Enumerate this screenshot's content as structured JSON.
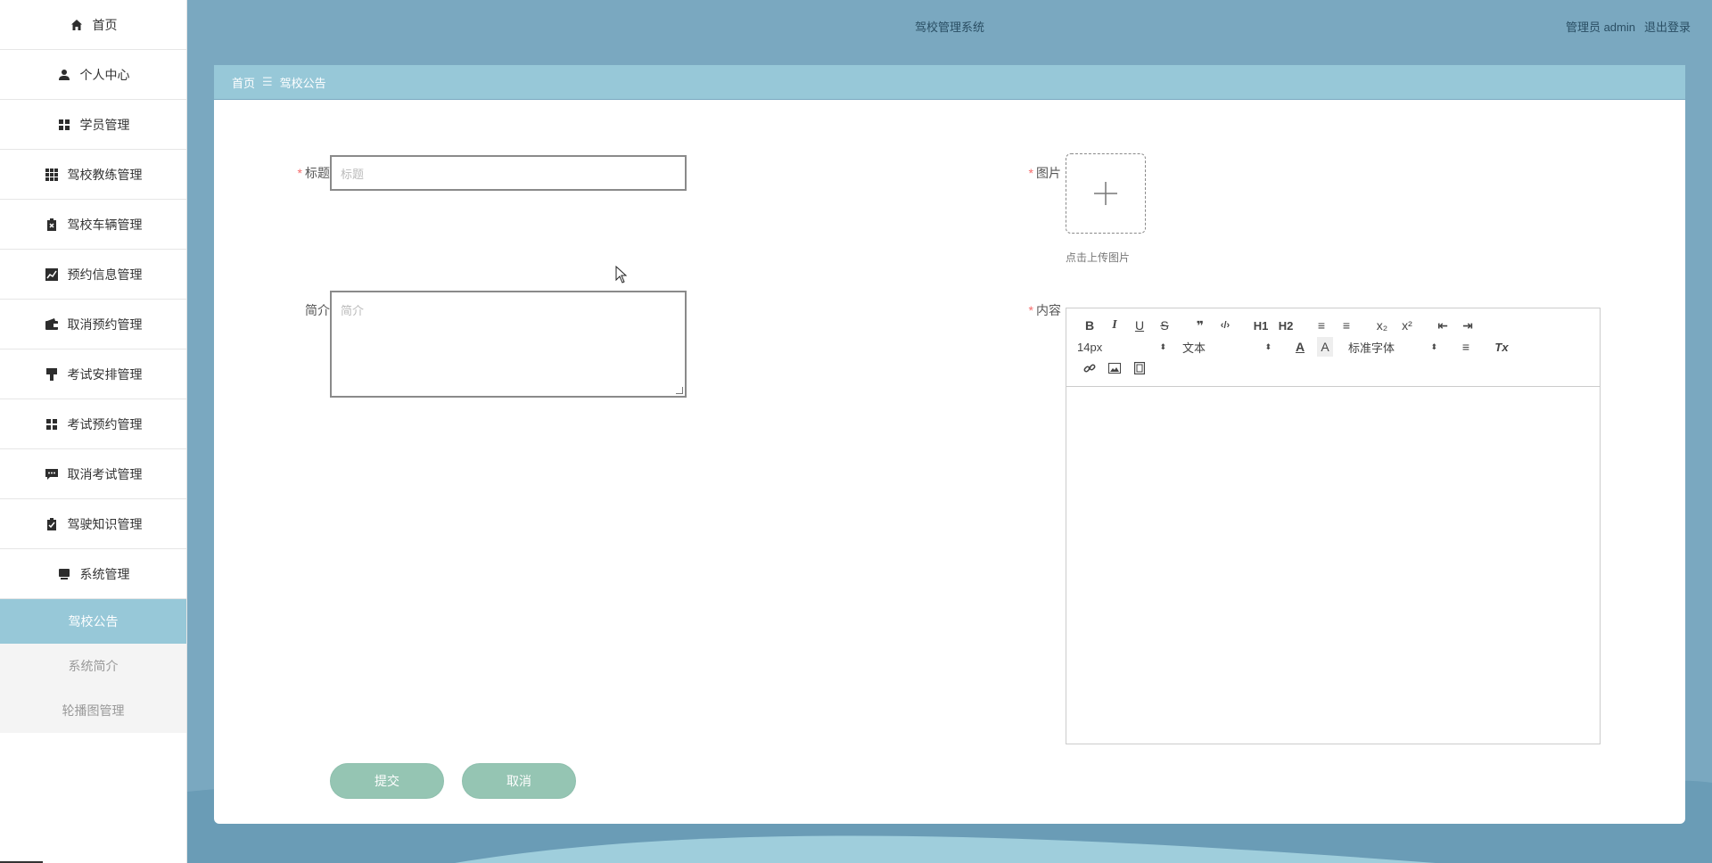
{
  "app": {
    "title": "驾校管理系统"
  },
  "header": {
    "user_label": "管理员 admin",
    "logout_label": "退出登录"
  },
  "sidebar": {
    "items": [
      {
        "label": "首页",
        "icon": "home-icon"
      },
      {
        "label": "个人中心",
        "icon": "user-icon"
      },
      {
        "label": "学员管理",
        "icon": "grid-icon"
      },
      {
        "label": "驾校教练管理",
        "icon": "apps-icon"
      },
      {
        "label": "驾校车辆管理",
        "icon": "clipboard-icon"
      },
      {
        "label": "预约信息管理",
        "icon": "chart-icon"
      },
      {
        "label": "取消预约管理",
        "icon": "wallet-icon"
      },
      {
        "label": "考试安排管理",
        "icon": "brush-icon"
      },
      {
        "label": "考试预约管理",
        "icon": "grid-icon"
      },
      {
        "label": "取消考试管理",
        "icon": "message-icon"
      },
      {
        "label": "驾驶知识管理",
        "icon": "checklist-icon"
      },
      {
        "label": "系统管理",
        "icon": "monitor-icon"
      }
    ],
    "sub_items": [
      {
        "label": "驾校公告",
        "active": true
      },
      {
        "label": "系统简介",
        "active": false
      },
      {
        "label": "轮播图管理",
        "active": false
      }
    ]
  },
  "breadcrumb": {
    "home": "首页",
    "separator": "☰",
    "current": "驾校公告"
  },
  "form": {
    "title_label": "标题",
    "title_placeholder": "标题",
    "intro_label": "简介",
    "intro_placeholder": "简介",
    "image_label": "图片",
    "upload_hint": "点击上传图片",
    "content_label": "内容",
    "required_mark": "*"
  },
  "editor": {
    "row1": [
      {
        "label": "B",
        "icon": "bold-icon"
      },
      {
        "label": "I",
        "icon": "italic-icon"
      },
      {
        "label": "U",
        "icon": "underline-icon"
      },
      {
        "label": "S",
        "icon": "strike-icon"
      },
      {
        "label": "❞",
        "icon": "blockquote-icon"
      },
      {
        "label": "‹/›",
        "icon": "code-block-icon"
      },
      {
        "label": "H1",
        "icon": "header1-icon"
      },
      {
        "label": "H2",
        "icon": "header2-icon"
      },
      {
        "label": "≡",
        "icon": "ordered-list-icon"
      },
      {
        "label": "≡",
        "icon": "bullet-list-icon"
      },
      {
        "label": "x₂",
        "icon": "subscript-icon"
      },
      {
        "label": "x²",
        "icon": "superscript-icon"
      },
      {
        "label": "⇤",
        "icon": "outdent-icon"
      },
      {
        "label": "⇥",
        "icon": "indent-icon"
      }
    ],
    "size_value": "14px",
    "format_value": "文本",
    "font_value": "标准字体",
    "color_label": "A",
    "bg_label": "A",
    "align_label": "≡",
    "clean_label": "Tx"
  },
  "actions": {
    "submit_label": "提交",
    "cancel_label": "取消"
  },
  "colors": {
    "accent": "#97c8d8",
    "header": "#7aa8c0",
    "button": "#95c5b3",
    "required": "#f56c6c"
  }
}
